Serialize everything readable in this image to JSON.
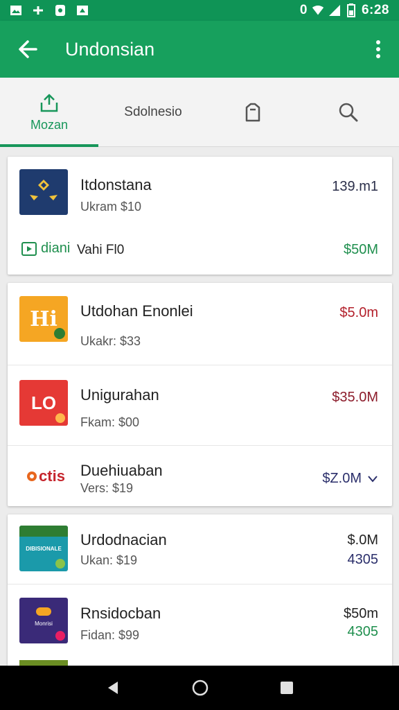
{
  "status_bar": {
    "time": "6:28",
    "wifi_label": "0"
  },
  "app_bar": {
    "title": "Undonsian"
  },
  "tabs": [
    {
      "label": "Mozan",
      "icon": "share-upload-icon",
      "active": true
    },
    {
      "label": "Sdolnesio",
      "icon": "",
      "active": false
    },
    {
      "label": "",
      "icon": "tag-icon",
      "active": false
    },
    {
      "label": "",
      "icon": "search-icon",
      "active": false
    }
  ],
  "card1": {
    "title": "Itdonstana",
    "subtitle": "Ukram $10",
    "amount": "139.m1",
    "footer_logo": "diani",
    "footer_text": "Vahi Fl0",
    "footer_amount": "$50M",
    "footer_amount_color": "#1f8f4e"
  },
  "card2": {
    "rows": [
      {
        "title": "Utdohan Enonlei",
        "subtitle": "Ukakr: $33",
        "amount": "$5.0m",
        "amount_color": "#b3202b",
        "thumb_text": "Hi"
      },
      {
        "title": "Unigurahan",
        "subtitle": "Fkam: $00",
        "amount": "$35.0M",
        "amount_color": "#8c1c2b",
        "thumb_text": "LO"
      },
      {
        "title": "Duehiuaban",
        "subtitle": "Vers: $19",
        "amount": "$Z.0M",
        "amount_color": "#2b2f6b",
        "thumb_text": "ctis"
      }
    ]
  },
  "card3": {
    "rows": [
      {
        "title": "Urdodnacian",
        "subtitle": "Ukan: $19",
        "amount": "$.0M",
        "amount2": "4305",
        "amount2_color": "#2b2f6b",
        "thumb_text": "DIBISIONALE"
      },
      {
        "title": "Rnsidocban",
        "subtitle": "Fidan: $99",
        "amount": "$50m",
        "amount2": "4305",
        "amount2_color": "#1f8f4e",
        "thumb_text": "Monrisi"
      }
    ]
  },
  "colors": {
    "primary": "#17a05d",
    "status": "#0f9456",
    "accent": "#17965a"
  }
}
